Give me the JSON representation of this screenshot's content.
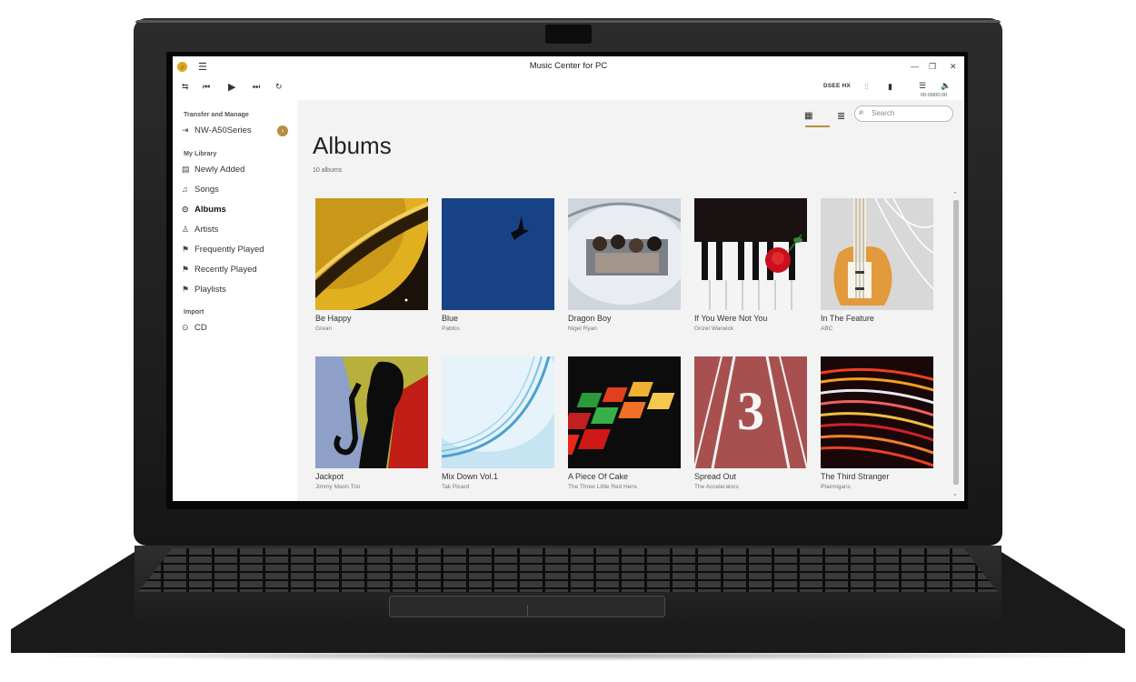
{
  "window": {
    "title": "Music Center for PC",
    "dsee_label": "DSEE HX",
    "time_display": "00:00/00:00"
  },
  "sidebar": {
    "transfer_heading": "Transfer and Manage",
    "device_name": "NW-A50Series",
    "library_heading": "My Library",
    "library_items": [
      {
        "label": "Newly Added",
        "icon": "newly-added-icon"
      },
      {
        "label": "Songs",
        "icon": "music-note-icon"
      },
      {
        "label": "Albums",
        "icon": "album-icon",
        "active": true
      },
      {
        "label": "Artists",
        "icon": "person-icon"
      },
      {
        "label": "Frequently Played",
        "icon": "flag-icon"
      },
      {
        "label": "Recently Played",
        "icon": "flag-icon"
      },
      {
        "label": "Playlists",
        "icon": "flag-icon"
      }
    ],
    "import_heading": "Import",
    "import_items": [
      {
        "label": "CD",
        "icon": "cd-icon"
      }
    ]
  },
  "search": {
    "placeholder": "Search"
  },
  "main": {
    "heading": "Albums",
    "album_count": "10 albums",
    "albums": [
      {
        "title": "Be Happy",
        "artist": "Grean"
      },
      {
        "title": "Blue",
        "artist": "Pablos"
      },
      {
        "title": "Dragon Boy",
        "artist": "Nigel Ryan"
      },
      {
        "title": "If You Were Not You",
        "artist": "Grizel Warwick"
      },
      {
        "title": "In The Feature",
        "artist": "ABC"
      },
      {
        "title": "Jackpot",
        "artist": "Jimmy Mann Trio"
      },
      {
        "title": "Mix Down Vol.1",
        "artist": "Tak Picard"
      },
      {
        "title": "A Piece Of Cake",
        "artist": "The Three Little Red Hens"
      },
      {
        "title": "Spread Out",
        "artist": "The Accelerators"
      },
      {
        "title": "The Third Stranger",
        "artist": "Ptarmigans"
      }
    ]
  },
  "colors": {
    "accent": "#b98d3e",
    "content_bg": "#f3f3f3"
  }
}
